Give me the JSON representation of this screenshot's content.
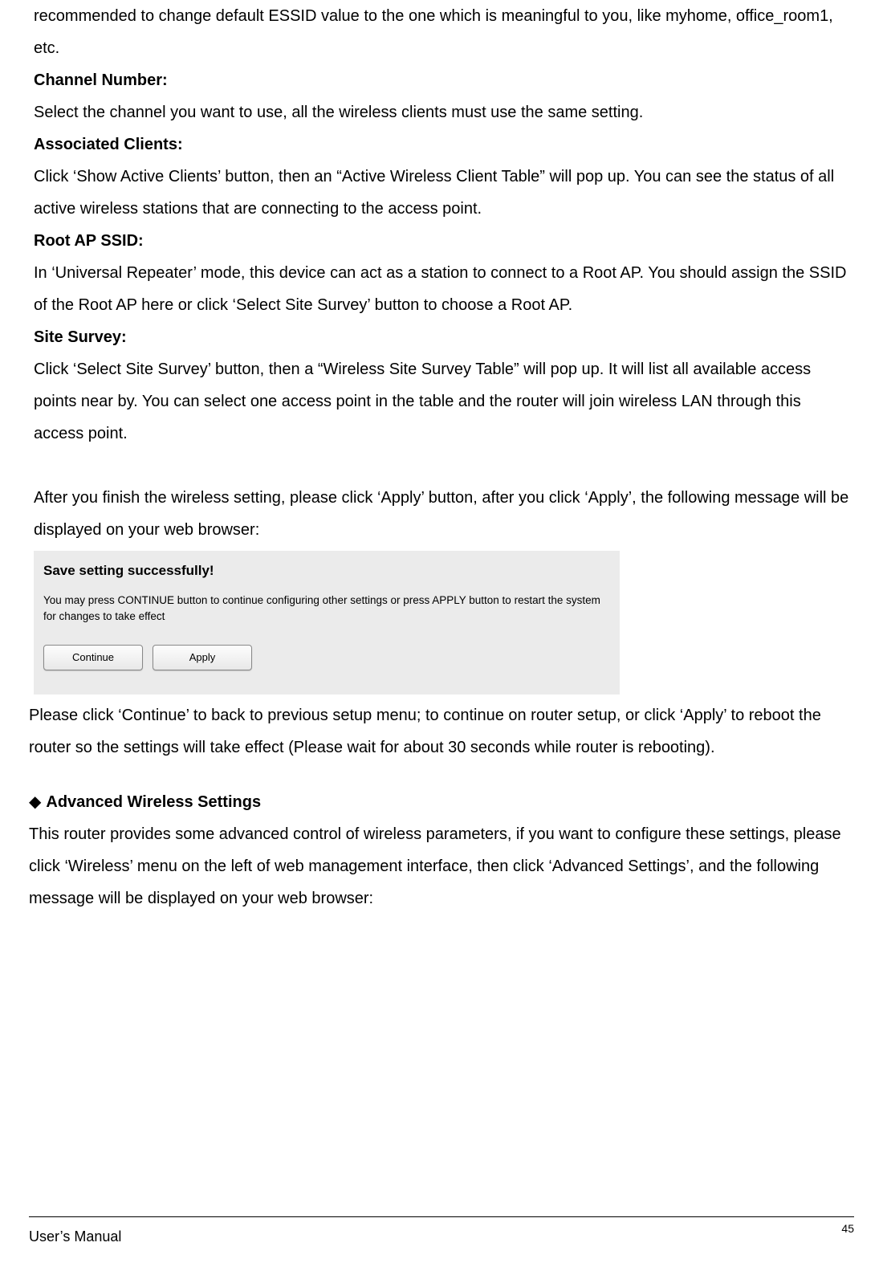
{
  "intro_line": "recommended to change default ESSID value to the one which is meaningful to you, like myhome, office_room1, etc.",
  "channel_heading": "Channel Number:",
  "channel_text": "Select the channel you want to use, all the wireless clients must use the same setting.",
  "assoc_heading": "Associated Clients:",
  "assoc_text": "Click ‘Show Active Clients’ button, then an “Active Wireless Client Table” will pop up. You can see the status of all active wireless stations that are connecting to the access point.",
  "root_heading": "Root AP SSID:",
  "root_text": "In ‘Universal Repeater’ mode, this device can act as a station to connect to a Root AP. You should assign the SSID of the Root AP here or click ‘Select Site Survey’ button to choose a Root AP.",
  "site_heading": "Site Survey:",
  "site_text": "Click ‘Select Site Survey’ button, then a “Wireless Site Survey Table” will pop up. It will list all available access points near by. You can select one access point in the table and the router will join wireless LAN through this access point.",
  "apply_text": "After you finish the wireless setting, please click ‘Apply’ button, after you click ‘Apply’, the following message will be displayed on your web browser:",
  "dialog": {
    "title": "Save setting successfully!",
    "body": "You may press CONTINUE button to continue configuring other settings or press APPLY button to restart the system for changes to take effect",
    "continue_label": "Continue",
    "apply_label": "Apply"
  },
  "post_dialog_text": "Please click ‘Continue’ to back to previous setup menu; to continue on router setup, or click ‘Apply’ to reboot the router so the settings will take effect (Please wait for about 30 seconds while router is rebooting).",
  "adv_heading": "Advanced Wireless Settings",
  "adv_text": "This router provides some advanced control of wireless parameters, if you want to configure these settings, please click ‘Wireless’ menu on the left of web management interface, then click ‘Advanced Settings’, and the following message will be displayed on your web browser:",
  "footer_left": "User’s Manual",
  "footer_right": "45"
}
